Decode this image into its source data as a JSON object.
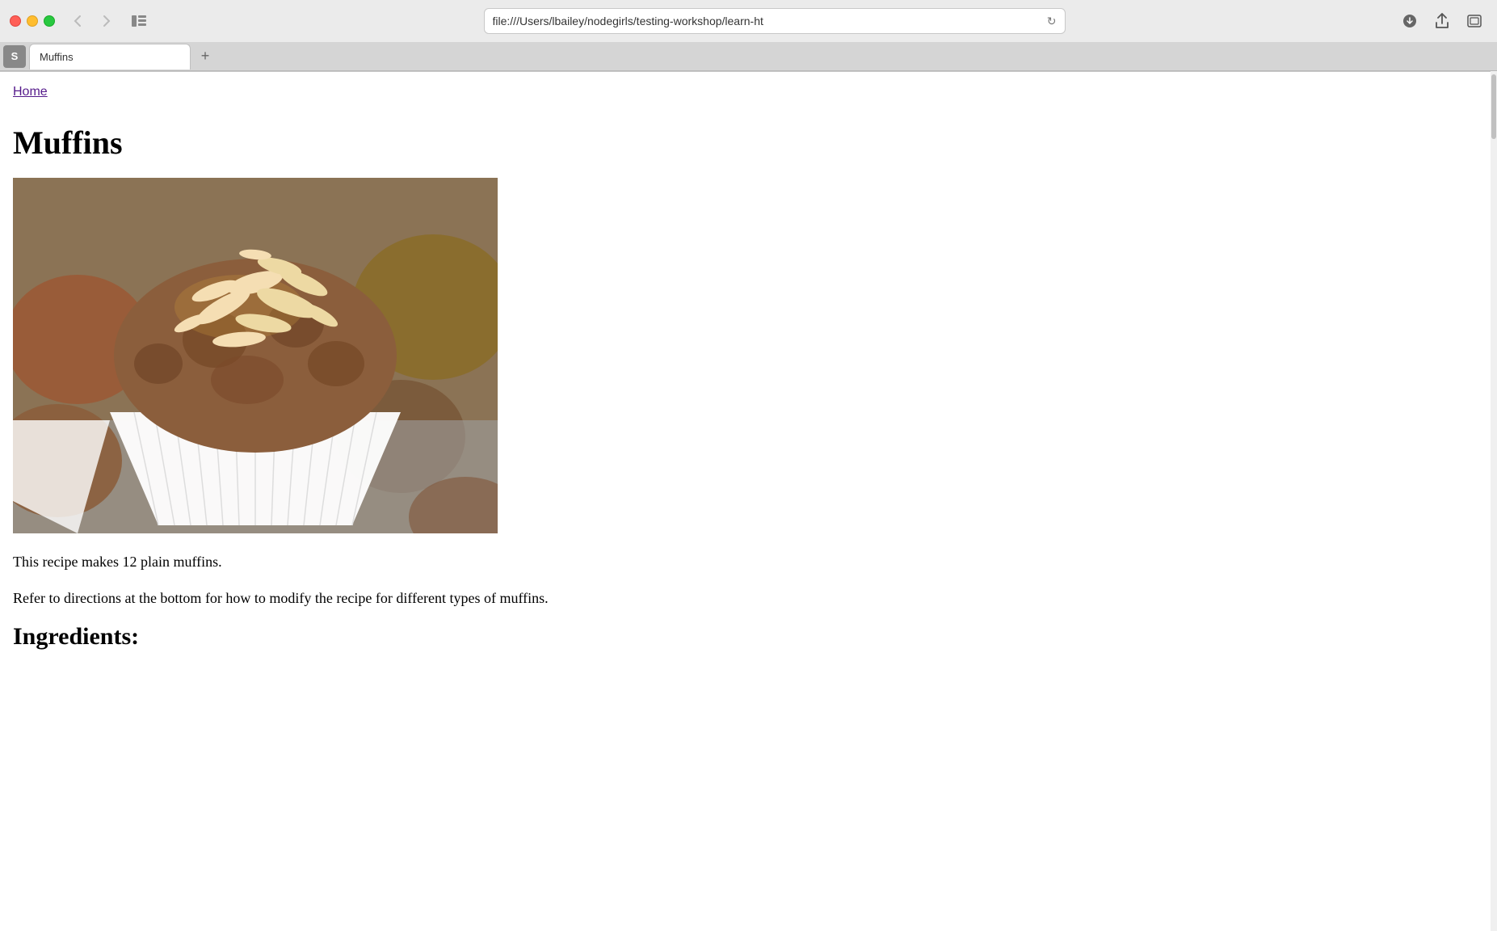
{
  "browser": {
    "url": "file:///Users/lbailey/nodegirls/testing-workshop/learn-ht",
    "tab_title": "Muffins",
    "tab_favicon": "S",
    "new_tab_label": "+",
    "back_button": "‹",
    "forward_button": "›",
    "sidebar_button": "⊡",
    "refresh_button": "↻",
    "download_icon": "⬇",
    "share_icon": "⬆",
    "window_icon": "⧉"
  },
  "page": {
    "home_link": "Home",
    "title": "Muffins",
    "recipe_text_1": "This recipe makes 12 plain muffins.",
    "recipe_text_2": "Refer to directions at the bottom for how to modify the recipe for different types of muffins.",
    "ingredients_heading": "Ingredients:"
  },
  "colors": {
    "home_link": "#551a8b",
    "accent": "#551a8b"
  }
}
